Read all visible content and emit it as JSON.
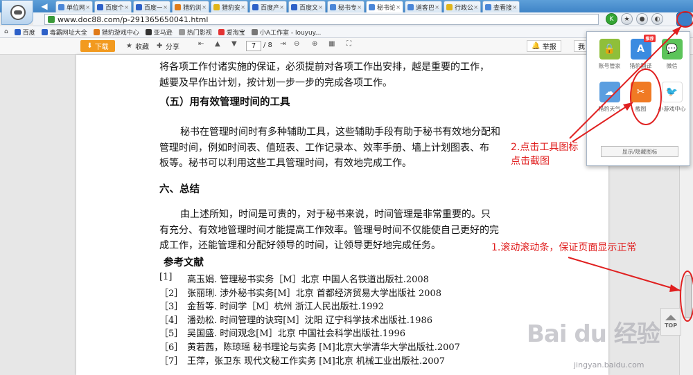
{
  "browser": {
    "url": "www.doc88.com/p-291365650041.html",
    "tabs": [
      {
        "label": "单位网...",
        "color": "#4a86d8"
      },
      {
        "label": "百度个...",
        "color": "#2d60c8"
      },
      {
        "label": "百度一...",
        "color": "#2d60c8"
      },
      {
        "label": "猎豹浏...",
        "color": "#e07b1a"
      },
      {
        "label": "猎豹安...",
        "color": "#e0b51a"
      },
      {
        "label": "百度产...",
        "color": "#2d60c8"
      },
      {
        "label": "百度文...",
        "color": "#2d60c8"
      },
      {
        "label": "秘书专...",
        "color": "#4a86d8"
      },
      {
        "label": "秘书论...",
        "color": "#4a86d8"
      },
      {
        "label": "道客巴...",
        "color": "#4a86d8"
      },
      {
        "label": "行政公...",
        "color": "#e0b51a"
      },
      {
        "label": "查看接...",
        "color": "#4a86d8"
      }
    ],
    "active_tab_index": 8,
    "tab_close": "×",
    "back_arrow": "◀"
  },
  "bookmarks": [
    {
      "label": "百度",
      "color": "#2d60c8"
    },
    {
      "label": "毒霸网址大全",
      "color": "#2d60c8"
    },
    {
      "label": "猎豹游戏中心",
      "color": "#e07b1a"
    },
    {
      "label": "亚马逊",
      "color": "#333333"
    },
    {
      "label": "热门影视",
      "color": "#999999"
    },
    {
      "label": "爱淘宝",
      "color": "#e33333"
    },
    {
      "label": "小A工作室 - louyuy...",
      "color": "#777777"
    }
  ],
  "doc_toolbar": {
    "download": "下载",
    "collect": "收藏",
    "share": "分享",
    "page_current": "7",
    "page_total": "/ 8",
    "report": "举报",
    "report2": "我"
  },
  "document": {
    "intro_line1": "将各项工作付诸实施的保证，必须提前对各项工作出安排，越是重要的工作，",
    "intro_line2": "越要及早作出计划，按计划一步一步的完成各项工作。",
    "section5_title": "（五）用有效管理时间的工具",
    "section5_p1": "秘书在管理时间时有多种辅助工具，这些辅助手段有助于秘书有效地分配和",
    "section5_p2": "管理时间，例如时间表、值班表、工作记录本、效率手册、墙上计划图表、布",
    "section5_p3": "板等。秘书可以利用这些工具管理时间，有效地完成工作。",
    "section6_title": "六、总结",
    "section6_p1": "由上述所知，时间是可贵的，对于秘书来说，时间管理是非常重要的。只",
    "section6_p2": "有充分、有效地管理时间才能提高工作效率。管理号时间不仅能使自己更好的完",
    "section6_p3": "成工作，还能管理和分配好领导的时间，让领导更好地完成任务。",
    "refs_title": "参考文献",
    "references": [
      {
        "num": "[1]",
        "text": "高玉娟. 管理秘书实务［M］北京 中国人名铁道出版社.2008"
      },
      {
        "num": "［2］",
        "text": "张丽琍. 涉外秘书实务[M］北京 首都经济贸易大学出版社 2008"
      },
      {
        "num": "［3］",
        "text": "金哲等. 时间学［M］杭州 浙江人民出版社.1992"
      },
      {
        "num": "［4］",
        "text": "潘劲松. 时间管理的诀窍[M］沈阳 辽宁科学技术出版社.1986"
      },
      {
        "num": "［5］",
        "text": "吴国盛. 时间观念[M］北京 中国社会科学出版社.1996"
      },
      {
        "num": "［6］",
        "text": "黄若茜，陈琼瑶 秘书理论与实务 [M]北京大学清华大学出版社.2007"
      },
      {
        "num": "［7］",
        "text": "王萍，张卫东 现代文秘工作实务 [M]北京 机械工业出版社.2007"
      }
    ]
  },
  "popup": {
    "apps": [
      {
        "label": "账号管家",
        "color": "#8fbf3a",
        "glyph": "🔒",
        "badge": ""
      },
      {
        "label": "猎豹翻译",
        "color": "#3b8be0",
        "glyph": "A",
        "badge": "推荐"
      },
      {
        "label": "微信",
        "color": "#5cc45a",
        "glyph": "💬",
        "badge": ""
      },
      {
        "label": "猎豹天气",
        "color": "#5b9ee0",
        "glyph": "☁",
        "badge": ""
      },
      {
        "label": "截图",
        "color": "#f07a24",
        "glyph": "✂",
        "badge": ""
      },
      {
        "label": "小游戏中心",
        "color": "#ffffff",
        "glyph": "🐦",
        "badge": ""
      }
    ],
    "toggle_label": "显示/隐藏图标"
  },
  "annotations": {
    "step2_line1": "2.点击工具图标",
    "step2_line2": "点击截图",
    "step1": "1.滚动滚动条，保证页面显示正常",
    "color": "#e02020"
  },
  "top_button": "TOP",
  "watermark": {
    "brand": "Bai du 经验",
    "site": "jingyan.baidu.com"
  }
}
